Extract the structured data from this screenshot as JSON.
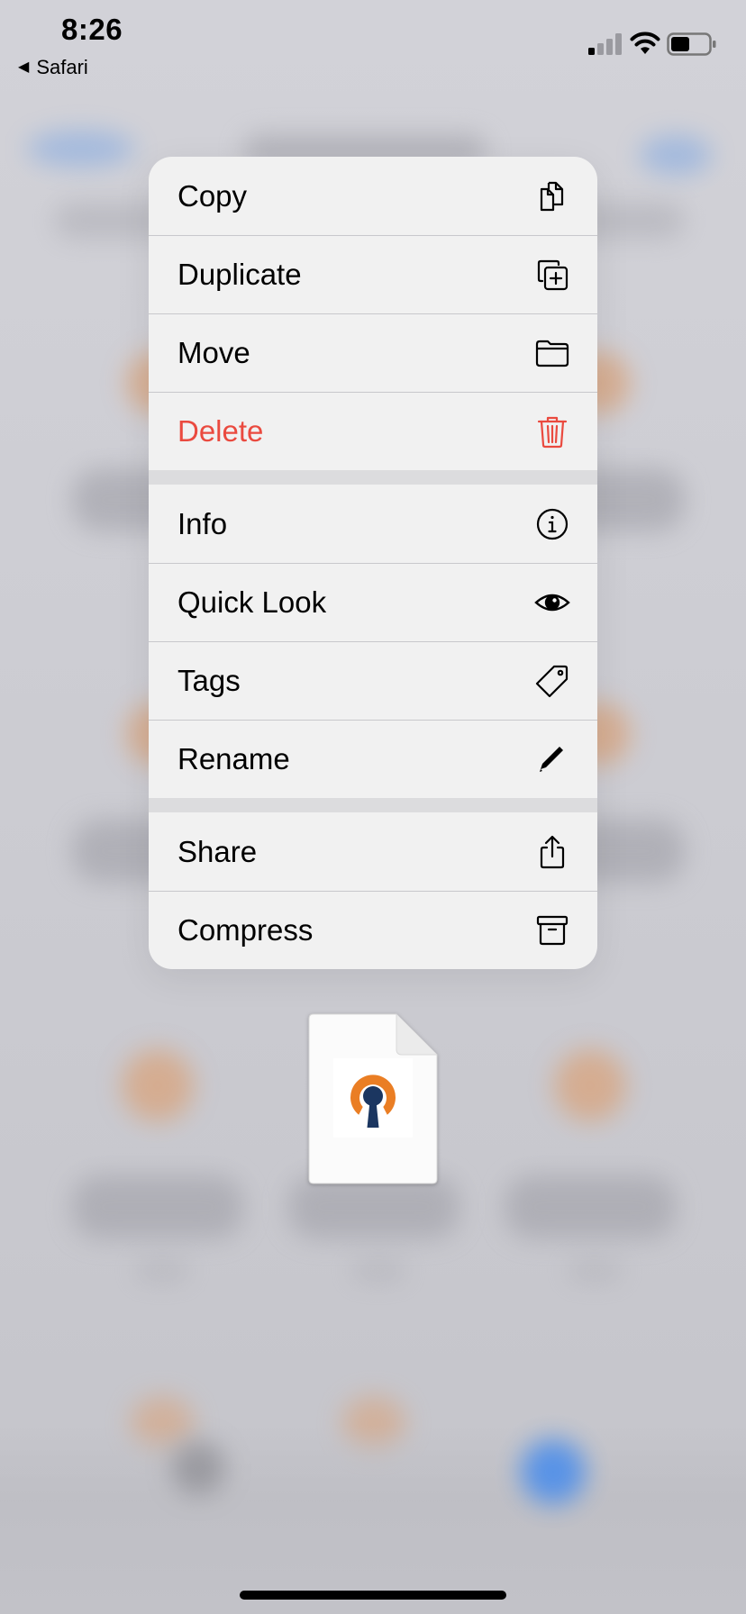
{
  "status_bar": {
    "time": "8:26",
    "back_app": "Safari",
    "back_icon": "back-triangle-icon"
  },
  "menu": {
    "groups": [
      [
        {
          "label": "Copy",
          "icon": "copy-icon",
          "destructive": false
        },
        {
          "label": "Duplicate",
          "icon": "duplicate-icon",
          "destructive": false
        },
        {
          "label": "Move",
          "icon": "folder-icon",
          "destructive": false
        },
        {
          "label": "Delete",
          "icon": "trash-icon",
          "destructive": true
        }
      ],
      [
        {
          "label": "Info",
          "icon": "info-icon",
          "destructive": false
        },
        {
          "label": "Quick Look",
          "icon": "eye-icon",
          "destructive": false
        },
        {
          "label": "Tags",
          "icon": "tag-icon",
          "destructive": false
        },
        {
          "label": "Rename",
          "icon": "pencil-icon",
          "destructive": false
        }
      ],
      [
        {
          "label": "Share",
          "icon": "share-icon",
          "destructive": false
        },
        {
          "label": "Compress",
          "icon": "archive-icon",
          "destructive": false
        }
      ]
    ]
  },
  "file_preview": {
    "icon": "openvpn-logo-icon"
  },
  "colors": {
    "destructive": "#ea4a3f",
    "menu_background": "#f1f1f1",
    "logo_orange": "#ea7e24",
    "logo_navy": "#1b3660"
  }
}
